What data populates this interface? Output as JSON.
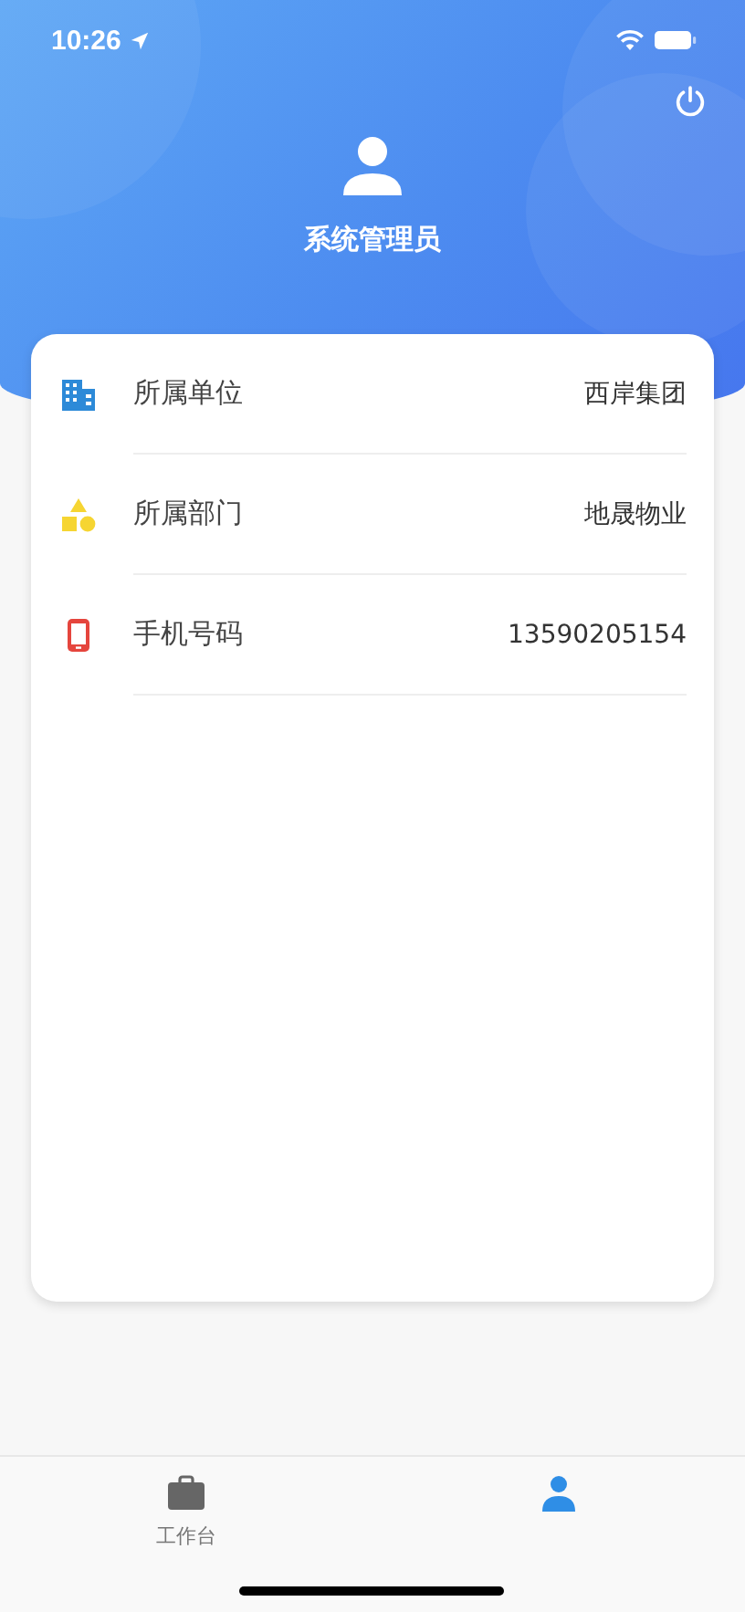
{
  "status_bar": {
    "time": "10:26"
  },
  "profile": {
    "name": "系统管理员"
  },
  "info_rows": [
    {
      "label": "所属单位",
      "value": "西岸集团"
    },
    {
      "label": "所属部门",
      "value": "地晟物业"
    },
    {
      "label": "手机号码",
      "value": "13590205154"
    }
  ],
  "tab_bar": [
    {
      "label": "工作台",
      "selected": false
    },
    {
      "selected": true
    }
  ]
}
